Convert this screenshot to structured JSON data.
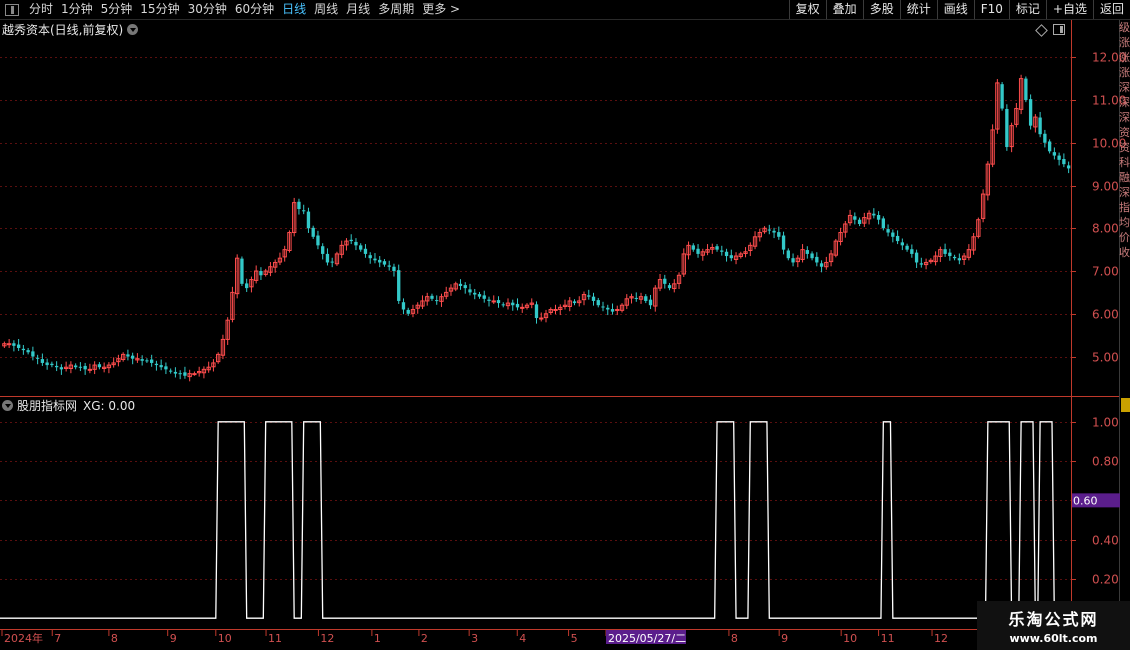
{
  "toolbar": {
    "items": [
      "分时",
      "1分钟",
      "5分钟",
      "15分钟",
      "30分钟",
      "60分钟",
      "日线",
      "周线",
      "月线",
      "多周期",
      "更多 >"
    ],
    "active_index": 6,
    "right_buttons": [
      "复权",
      "叠加",
      "多股",
      "统计",
      "画线",
      "F10",
      "标记",
      "+自选",
      "返回"
    ]
  },
  "chart_title": "越秀资本(日线,前复权)",
  "indicator": {
    "name": "股朋指标网",
    "value": "XG: 0.00"
  },
  "right_strip": [
    "级",
    "涨",
    "涨",
    "涨",
    "深",
    "深",
    "深",
    "资",
    "资",
    "科",
    "融",
    "深",
    "指",
    "均",
    "价",
    "收"
  ],
  "watermark": {
    "title": "乐淘公式网",
    "url": "www.60lt.com"
  },
  "colors": {
    "up": "#ff4d4d",
    "down": "#33c9c9",
    "grid": "#5a0f0f",
    "axis": "#c0392b",
    "signal": "#ffffff",
    "highlight": "#5b1e8c"
  },
  "chart_data": [
    {
      "type": "candlestick",
      "price_axis": {
        "ticks": [
          5.0,
          6.0,
          7.0,
          8.0,
          9.0,
          10.0,
          11.0,
          12.0
        ],
        "ylim": [
          4.1,
          12.45
        ]
      },
      "closes": [
        5.3,
        5.3,
        5.25,
        5.2,
        5.15,
        5.1,
        5.0,
        4.95,
        4.85,
        4.8,
        4.8,
        4.75,
        4.7,
        4.75,
        4.8,
        4.75,
        4.75,
        4.7,
        4.7,
        4.8,
        4.75,
        4.75,
        4.8,
        4.85,
        4.95,
        5.05,
        5.0,
        4.95,
        4.95,
        4.9,
        4.9,
        4.85,
        4.8,
        4.75,
        4.7,
        4.65,
        4.6,
        4.6,
        4.55,
        4.6,
        4.6,
        4.65,
        4.7,
        4.75,
        4.85,
        5.05,
        5.4,
        5.85,
        6.5,
        7.3,
        6.7,
        6.6,
        6.8,
        7.0,
        6.9,
        7.0,
        7.1,
        7.2,
        7.3,
        7.5,
        7.9,
        8.6,
        8.45,
        8.4,
        8.0,
        7.8,
        7.6,
        7.4,
        7.2,
        7.2,
        7.4,
        7.6,
        7.7,
        7.7,
        7.6,
        7.5,
        7.4,
        7.3,
        7.25,
        7.2,
        7.15,
        7.1,
        7.0,
        6.3,
        6.1,
        6.0,
        6.1,
        6.2,
        6.3,
        6.4,
        6.35,
        6.3,
        6.4,
        6.5,
        6.6,
        6.7,
        6.65,
        6.6,
        6.5,
        6.45,
        6.4,
        6.35,
        6.3,
        6.3,
        6.25,
        6.2,
        6.25,
        6.2,
        6.15,
        6.15,
        6.2,
        6.25,
        5.9,
        5.9,
        6.0,
        6.1,
        6.1,
        6.15,
        6.2,
        6.3,
        6.25,
        6.3,
        6.45,
        6.4,
        6.3,
        6.2,
        6.15,
        6.1,
        6.05,
        6.1,
        6.2,
        6.35,
        6.4,
        6.35,
        6.4,
        6.3,
        6.2,
        6.6,
        6.8,
        6.7,
        6.6,
        6.7,
        6.9,
        7.4,
        7.6,
        7.5,
        7.4,
        7.45,
        7.5,
        7.55,
        7.5,
        7.45,
        7.35,
        7.3,
        7.35,
        7.4,
        7.45,
        7.6,
        7.8,
        7.9,
        8.0,
        7.95,
        7.9,
        7.8,
        7.5,
        7.3,
        7.2,
        7.3,
        7.5,
        7.4,
        7.3,
        7.2,
        7.1,
        7.2,
        7.4,
        7.7,
        7.9,
        8.1,
        8.3,
        8.2,
        8.1,
        8.25,
        8.35,
        8.3,
        8.2,
        8.0,
        7.9,
        7.8,
        7.7,
        7.6,
        7.5,
        7.4,
        7.2,
        7.15,
        7.2,
        7.25,
        7.35,
        7.5,
        7.4,
        7.35,
        7.3,
        7.25,
        7.35,
        7.5,
        7.8,
        8.2,
        8.8,
        9.5,
        10.3,
        11.4,
        10.8,
        9.9,
        10.4,
        10.8,
        11.5,
        11.0,
        10.4,
        10.6,
        10.2,
        10.0,
        9.8,
        9.7,
        9.6,
        9.5,
        9.4
      ],
      "signals": [
        [
          45,
          50
        ],
        [
          55,
          60
        ],
        [
          63,
          66
        ],
        [
          150,
          153
        ],
        [
          157,
          160
        ],
        [
          185,
          186
        ],
        [
          207,
          211
        ],
        [
          214,
          216
        ],
        [
          218,
          220
        ]
      ]
    },
    {
      "type": "line",
      "axis": {
        "ticks": [
          0.2,
          0.4,
          0.6,
          0.8,
          1.0
        ],
        "ylim": [
          -0.05,
          1.05
        ],
        "marker_value": "0.60"
      }
    }
  ],
  "date_axis": [
    {
      "label": "2024年",
      "frac": 0.0
    },
    {
      "label": "7",
      "frac": 0.047
    },
    {
      "label": "8",
      "frac": 0.1
    },
    {
      "label": "9",
      "frac": 0.155
    },
    {
      "label": "10",
      "frac": 0.2
    },
    {
      "label": "11",
      "frac": 0.247
    },
    {
      "label": "12",
      "frac": 0.296
    },
    {
      "label": "1",
      "frac": 0.346
    },
    {
      "label": "2",
      "frac": 0.39
    },
    {
      "label": "3",
      "frac": 0.437
    },
    {
      "label": "4",
      "frac": 0.482
    },
    {
      "label": "5",
      "frac": 0.53
    },
    {
      "label": "2025/05/27/二",
      "frac": 0.565,
      "highlight": true
    },
    {
      "label": "8",
      "frac": 0.68
    },
    {
      "label": "9",
      "frac": 0.727
    },
    {
      "label": "10",
      "frac": 0.785
    },
    {
      "label": "11",
      "frac": 0.82
    },
    {
      "label": "12",
      "frac": 0.87
    }
  ]
}
